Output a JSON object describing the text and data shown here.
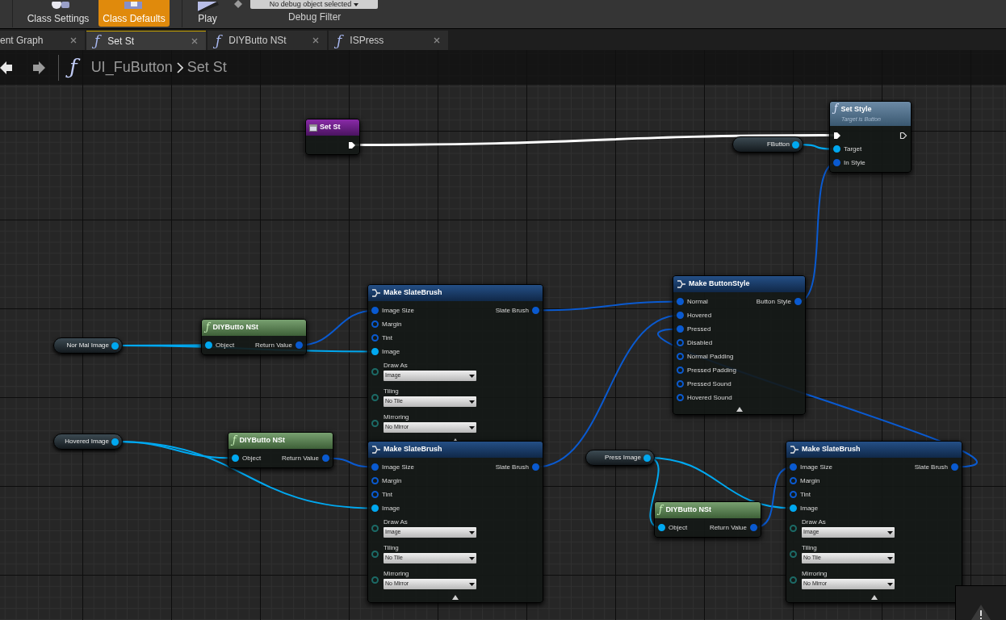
{
  "toolbar": {
    "buttons": [
      {
        "label": "Class Settings",
        "selected": false
      },
      {
        "label": "Class Defaults",
        "selected": true
      },
      {
        "label": "Play",
        "selected": false
      }
    ],
    "debug_dropdown": "No debug object selected",
    "debug_label": "Debug Filter"
  },
  "tabs": [
    {
      "label": "ent Graph",
      "selected": false
    },
    {
      "label": "Set St",
      "icon": "ƒ",
      "selected": true
    },
    {
      "label": "DIYButto NSt",
      "icon": "ƒ",
      "selected": false
    },
    {
      "label": "ISPress",
      "icon": "ƒ",
      "selected": false
    }
  ],
  "breadcrumb": {
    "icon": "ƒ",
    "path": [
      "UI_FuButton",
      "Set St"
    ]
  },
  "nodes": [
    {
      "kind": "event",
      "title": "Set St",
      "exec_out": {
        "connected": true
      }
    },
    {
      "kind": "function",
      "icon": "ƒ",
      "title": "Set Style",
      "subtitle": "Target is Button",
      "exec_in": {
        "connected": true
      },
      "exec_out": {
        "connected": false
      },
      "inputs": [
        {
          "label": "Target",
          "connected": true,
          "color": "#00a8f0"
        },
        {
          "label": "In Style",
          "connected": true,
          "color": "#0a5ad0"
        }
      ]
    },
    {
      "kind": "variable",
      "title": "FButton",
      "outputs": [
        {
          "connected": true,
          "color": "#00a8f0"
        }
      ]
    },
    {
      "kind": "variable",
      "title": "Nor Mal Image",
      "outputs": [
        {
          "connected": true,
          "color": "#00a8f0"
        }
      ]
    },
    {
      "kind": "pure_function",
      "icon": "ƒ",
      "title": "DIYButto NSt",
      "inputs": [
        {
          "label": "Object",
          "connected": true,
          "color": "#00a8f0"
        }
      ],
      "outputs": [
        {
          "label": "Return Value",
          "connected": true,
          "color": "#0a5ad0"
        }
      ]
    },
    {
      "kind": "make",
      "title": "Make SlateBrush",
      "inputs": [
        {
          "label": "Image Size",
          "connected": true,
          "color": "#0a5ad0"
        },
        {
          "label": "Margin",
          "connected": false,
          "color": "#0a5ad0"
        },
        {
          "label": "Tint",
          "connected": false,
          "color": "#0a5ad0"
        },
        {
          "label": "Image",
          "connected": true,
          "color": "#00a8f0"
        }
      ],
      "outputs": [
        {
          "label": "Slate Brush",
          "connected": true,
          "color": "#0a5ad0"
        }
      ],
      "fields": [
        {
          "label": "Draw As",
          "value": "Image"
        },
        {
          "label": "Tiling",
          "value": "No Tile"
        },
        {
          "label": "Mirroring",
          "value": "No Mirror"
        }
      ]
    },
    {
      "kind": "make",
      "title": "Make ButtonStyle",
      "inputs": [
        {
          "label": "Normal",
          "connected": true,
          "color": "#0a5ad0"
        },
        {
          "label": "Hovered",
          "connected": true,
          "color": "#0a5ad0"
        },
        {
          "label": "Pressed",
          "connected": true,
          "color": "#0a5ad0"
        },
        {
          "label": "Disabled",
          "connected": false,
          "color": "#0a5ad0"
        },
        {
          "label": "Normal Padding",
          "connected": false,
          "color": "#0a5ad0"
        },
        {
          "label": "Pressed Padding",
          "connected": false,
          "color": "#0a5ad0"
        },
        {
          "label": "Pressed Sound",
          "connected": false,
          "color": "#0a5ad0"
        },
        {
          "label": "Hovered Sound",
          "connected": false,
          "color": "#0a5ad0"
        }
      ],
      "outputs": [
        {
          "label": "Button Style",
          "connected": true,
          "color": "#0a5ad0"
        }
      ]
    },
    {
      "kind": "variable",
      "title": "Hovered Image",
      "outputs": [
        {
          "connected": true,
          "color": "#00a8f0"
        }
      ]
    },
    {
      "kind": "pure_function",
      "icon": "ƒ",
      "title": "DIYButto NSt",
      "inputs": [
        {
          "label": "Object",
          "connected": true,
          "color": "#00a8f0"
        }
      ],
      "outputs": [
        {
          "label": "Return Value",
          "connected": true,
          "color": "#0a5ad0"
        }
      ]
    },
    {
      "kind": "make",
      "title": "Make SlateBrush",
      "inputs": [
        {
          "label": "Image Size",
          "connected": true,
          "color": "#0a5ad0"
        },
        {
          "label": "Margin",
          "connected": false,
          "color": "#0a5ad0"
        },
        {
          "label": "Tint",
          "connected": false,
          "color": "#0a5ad0"
        },
        {
          "label": "Image",
          "connected": true,
          "color": "#00a8f0"
        }
      ],
      "outputs": [
        {
          "label": "Slate Brush",
          "connected": true,
          "color": "#0a5ad0"
        }
      ],
      "fields": [
        {
          "label": "Draw As",
          "value": "Image"
        },
        {
          "label": "Tiling",
          "value": "No Tile"
        },
        {
          "label": "Mirroring",
          "value": "No Mirror"
        }
      ]
    },
    {
      "kind": "variable",
      "title": "Press Image",
      "outputs": [
        {
          "connected": true,
          "color": "#00a8f0"
        }
      ]
    },
    {
      "kind": "pure_function",
      "icon": "ƒ",
      "title": "DIYButto NSt",
      "inputs": [
        {
          "label": "Object",
          "connected": true,
          "color": "#00a8f0"
        }
      ],
      "outputs": [
        {
          "label": "Return Value",
          "connected": true,
          "color": "#0a5ad0"
        }
      ]
    },
    {
      "kind": "make",
      "title": "Make SlateBrush",
      "inputs": [
        {
          "label": "Image Size",
          "connected": true,
          "color": "#0a5ad0"
        },
        {
          "label": "Margin",
          "connected": false,
          "color": "#0a5ad0"
        },
        {
          "label": "Tint",
          "connected": false,
          "color": "#0a5ad0"
        },
        {
          "label": "Image",
          "connected": true,
          "color": "#00a8f0"
        }
      ],
      "outputs": [
        {
          "label": "Slate Brush",
          "connected": true,
          "color": "#0a5ad0"
        }
      ],
      "fields": [
        {
          "label": "Draw As",
          "value": "Image"
        },
        {
          "label": "Tiling",
          "value": "No Tile"
        },
        {
          "label": "Mirroring",
          "value": "No Mirror"
        }
      ]
    }
  ]
}
